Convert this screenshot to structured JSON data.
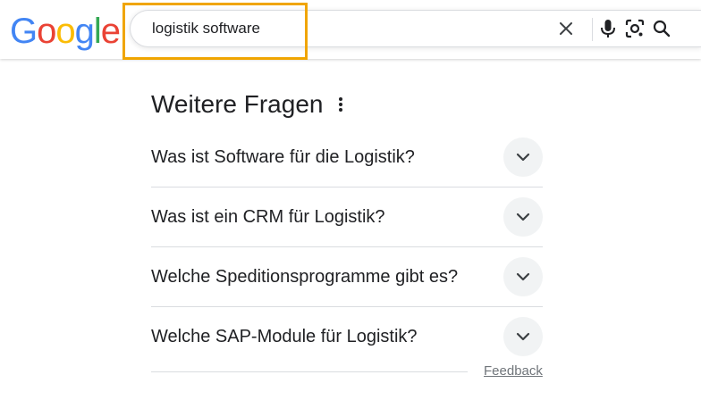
{
  "logo": {
    "letters": [
      "G",
      "o",
      "o",
      "g",
      "l",
      "e"
    ],
    "colors": [
      "#4285f4",
      "#ea4335",
      "#fbbc05",
      "#4285f4",
      "#34a853",
      "#ea4335"
    ]
  },
  "search": {
    "value": "logistik software",
    "highlight_color": "#f0a500",
    "icons": [
      "clear-icon",
      "microphone-icon",
      "lens-icon",
      "search-icon"
    ]
  },
  "related_questions": {
    "title": "Weitere Fragen",
    "items": [
      {
        "question": "Was ist Software für die Logistik?"
      },
      {
        "question": "Was ist ein CRM für Logistik?"
      },
      {
        "question": "Welche Speditionsprogramme gibt es?"
      },
      {
        "question": "Welche SAP-Module für Logistik?"
      }
    ]
  },
  "feedback_label": "Feedback"
}
